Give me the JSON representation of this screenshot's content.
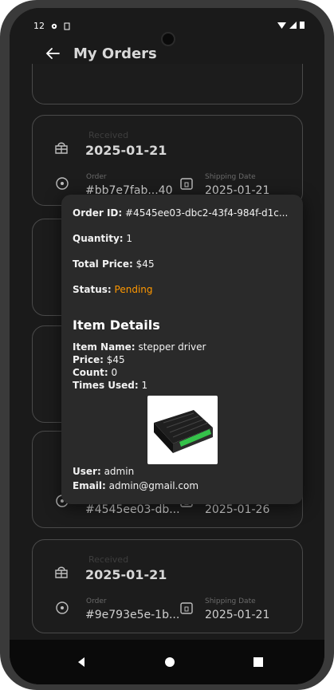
{
  "status": {
    "time": "12",
    "icons": [
      "gear-icon",
      "clipboard-icon"
    ],
    "right_icons": [
      "wifi-icon",
      "signal-icon",
      "battery-icon"
    ]
  },
  "appbar": {
    "title": "My Orders"
  },
  "cards": [
    {
      "status": "Received",
      "date": "2025-01-21",
      "order_label": "Order",
      "order_id": "#bb7e7fab...40",
      "ship_label": "Shipping Date",
      "ship_date": "2025-01-21"
    },
    {
      "status": "",
      "date": "",
      "order_label": "",
      "order_id": "#4545ee03-db...",
      "ship_label": "",
      "ship_date": "2025-01-26"
    },
    {
      "status": "Received",
      "date": "2025-01-21",
      "order_label": "Order",
      "order_id": "#9e793e5e-1b...",
      "ship_label": "Shipping Date",
      "ship_date": "2025-01-21"
    }
  ],
  "dialog": {
    "order_id_label": "Order ID:",
    "order_id": "#4545ee03-dbc2-43f4-984f-d1c...",
    "quantity_label": "Quantity:",
    "quantity": "1",
    "total_label": "Total Price:",
    "total": "$45",
    "status_label": "Status:",
    "status": "Pending",
    "item_details_title": "Item Details",
    "item_name_label": "Item Name:",
    "item_name": "stepper driver",
    "price_label": "Price:",
    "price": "$45",
    "count_label": "Count:",
    "count": "0",
    "times_used_label": "Times Used:",
    "times_used": "1",
    "user_label": "User:",
    "user": "admin",
    "email_label": "Email:",
    "email": "admin@gmail.com"
  },
  "navbar": {
    "icons": [
      "back-triangle-icon",
      "home-circle-icon",
      "recent-square-icon"
    ]
  },
  "colors": {
    "background": "#1a1a1a",
    "card_border": "#4a4a4a",
    "status_pending": "#ff9800",
    "dialog_bg": "#2a2a2a"
  }
}
